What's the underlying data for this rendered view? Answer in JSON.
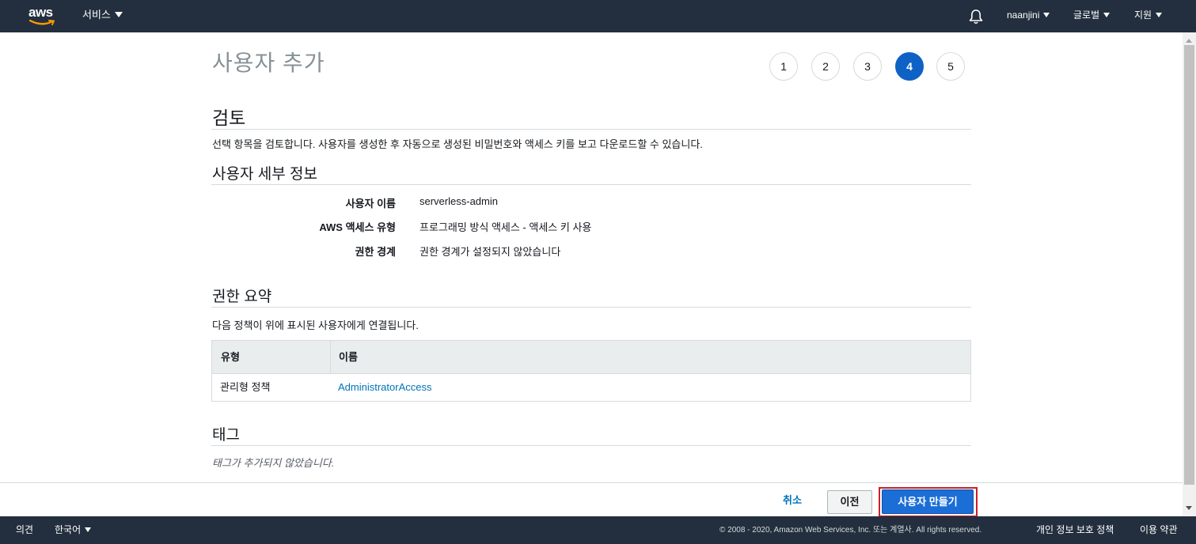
{
  "topnav": {
    "logo_text": "aws",
    "services_label": "서비스",
    "account_label": "naanjini",
    "region_label": "글로벌",
    "support_label": "지원"
  },
  "page": {
    "title": "사용자 추가",
    "steps": [
      "1",
      "2",
      "3",
      "4",
      "5"
    ],
    "active_step": "4"
  },
  "review": {
    "heading": "검토",
    "description": "선택 항목을 검토합니다. 사용자를 생성한 후 자동으로 생성된 비밀번호와 액세스 키를 보고 다운로드할 수 있습니다."
  },
  "user_details": {
    "heading": "사용자 세부 정보",
    "rows": [
      {
        "label": "사용자 이름",
        "value": "serverless-admin"
      },
      {
        "label": "AWS 액세스 유형",
        "value": "프로그래밍 방식 액세스 - 액세스 키 사용"
      },
      {
        "label": "권한 경계",
        "value": "권한 경계가 설정되지 않았습니다"
      }
    ]
  },
  "permissions": {
    "heading": "권한 요약",
    "description": "다음 정책이 위에 표시된 사용자에게 연결됩니다.",
    "columns": [
      "유형",
      "이름"
    ],
    "rows": [
      {
        "type": "관리형 정책",
        "name": "AdministratorAccess"
      }
    ]
  },
  "tags": {
    "heading": "태그",
    "empty_note": "태그가 추가되지 않았습니다."
  },
  "actions": {
    "cancel_label": "취소",
    "previous_label": "이전",
    "create_label": "사용자 만들기"
  },
  "footer": {
    "feedback_label": "의견",
    "language_label": "한국어",
    "copyright": "© 2008 - 2020, Amazon Web Services, Inc. 또는 계열사. All rights reserved.",
    "privacy_label": "개인 정보 보호 정책",
    "terms_label": "이용 약관"
  },
  "colors": {
    "nav_bg": "#232f3e",
    "active_step": "#0f62c5",
    "primary_button": "#1a6ed6",
    "link": "#0073bb",
    "highlight_outline": "#d21d28"
  }
}
